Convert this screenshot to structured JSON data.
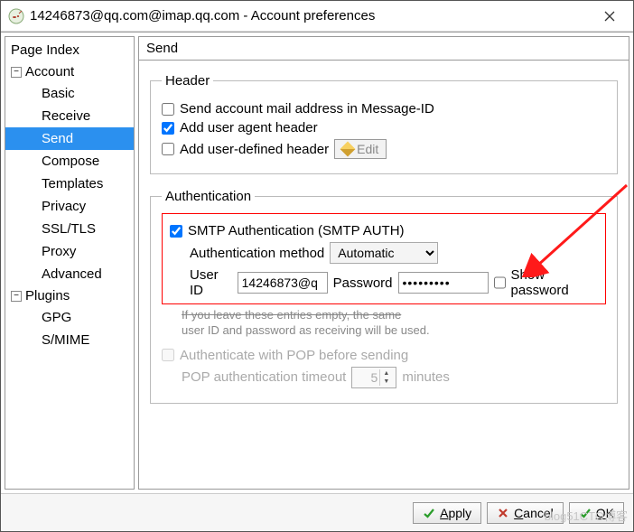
{
  "window": {
    "title": "14246873@qq.com@imap.qq.com - Account preferences"
  },
  "sidebar": {
    "header": "Page Index",
    "groups": [
      {
        "label": "Account",
        "items": [
          "Basic",
          "Receive",
          "Send",
          "Compose",
          "Templates",
          "Privacy",
          "SSL/TLS",
          "Proxy",
          "Advanced"
        ],
        "selected_index": 2
      },
      {
        "label": "Plugins",
        "items": [
          "GPG",
          "S/MIME"
        ],
        "selected_index": -1
      }
    ]
  },
  "pane": {
    "title": "Send",
    "header_group": {
      "legend": "Header",
      "send_msgid_label": "Send account mail address in Message-ID",
      "send_msgid_checked": false,
      "user_agent_label": "Add user agent header",
      "user_agent_checked": true,
      "user_defined_label": "Add user-defined header",
      "user_defined_checked": false,
      "edit_button": "Edit"
    },
    "auth_group": {
      "legend": "Authentication",
      "smtp_auth_label": "SMTP Authentication (SMTP AUTH)",
      "smtp_auth_checked": true,
      "auth_method_label": "Authentication method",
      "auth_method_value": "Automatic",
      "userid_label": "User ID",
      "userid_value": "14246873@q",
      "password_label": "Password",
      "password_value": "•••••••••",
      "show_password_label": "Show password",
      "show_password_checked": false,
      "hint_line1": "If you leave these entries empty, the same",
      "hint_line2": "user ID and password as receiving will be used.",
      "pop_before_label": "Authenticate with POP before sending",
      "pop_before_checked": false,
      "pop_timeout_label": "POP authentication timeout",
      "pop_timeout_value": "5",
      "pop_timeout_unit": "minutes"
    }
  },
  "buttons": {
    "apply": "Apply",
    "cancel": "Cancel",
    "ok": "OK"
  },
  "watermark": "blog51CTO博客"
}
